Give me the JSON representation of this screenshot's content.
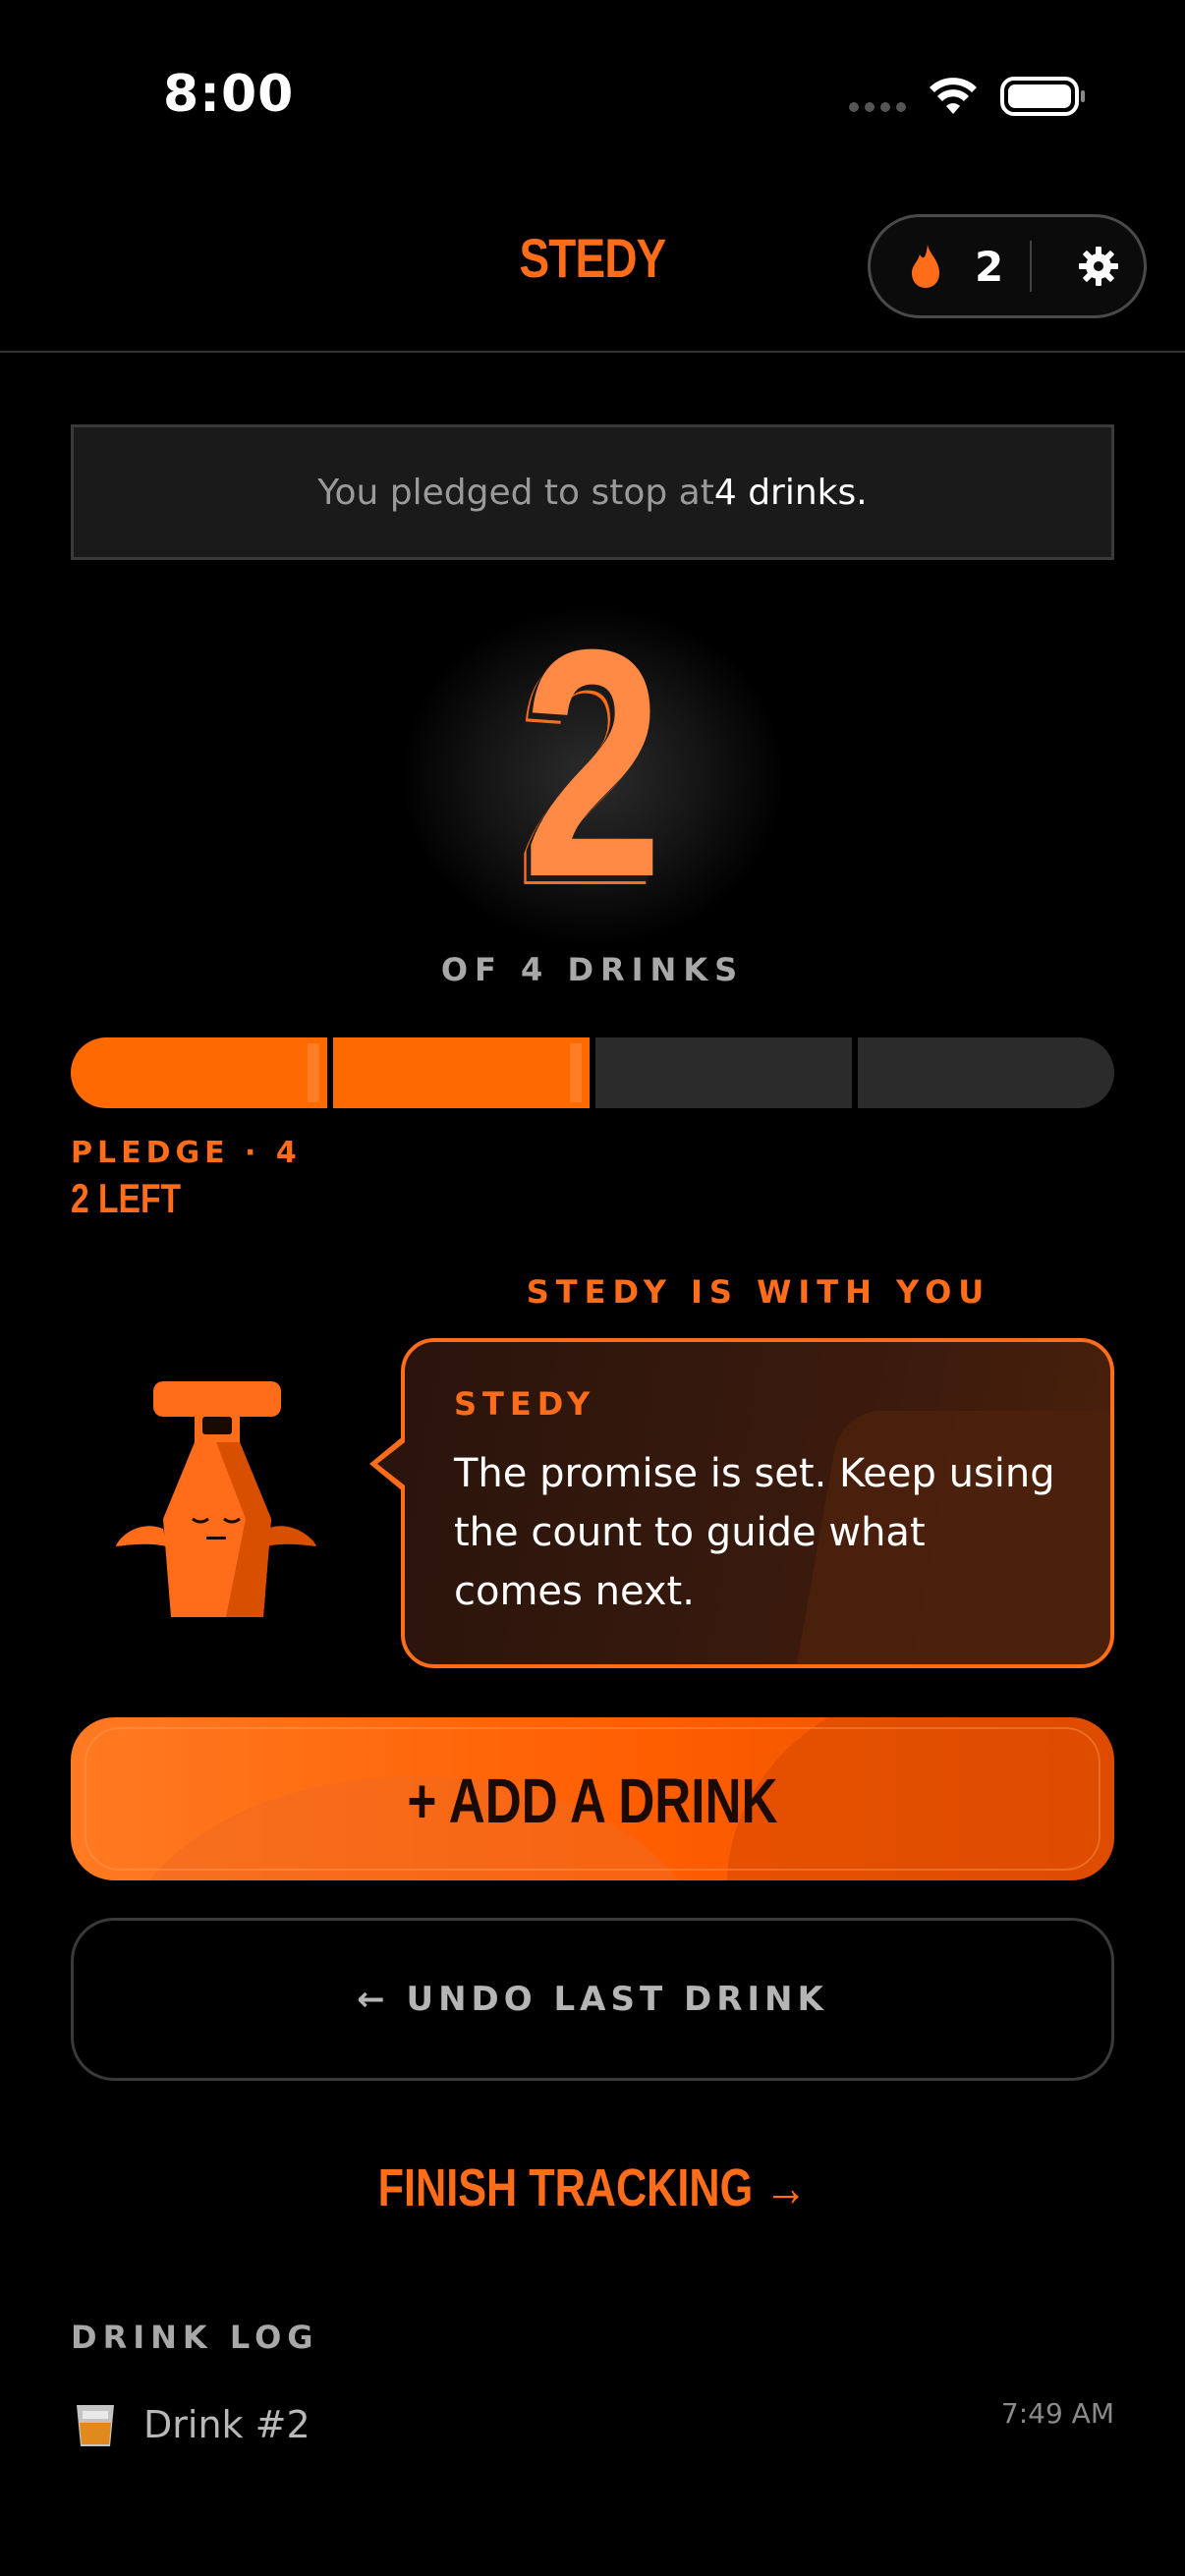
{
  "status_bar": {
    "time": "8:00"
  },
  "header": {
    "brand": "STEDY",
    "streak_count": "2"
  },
  "pledge_banner": {
    "prefix": "You pledged to stop at ",
    "highlight": "4 drinks."
  },
  "counter": {
    "current": "2",
    "caption": "OF 4 DRINKS"
  },
  "progress": {
    "total": 4,
    "filled": 2,
    "pledge_label": "PLEDGE · 4",
    "remaining_label": "2 LEFT"
  },
  "companion": {
    "heading": "STEDY IS WITH YOU",
    "name": "STEDY",
    "message": "The promise is set. Keep using the count to guide what comes next."
  },
  "actions": {
    "add_drink": "+ ADD A DRINK",
    "undo": "← UNDO LAST DRINK",
    "finish": "FINISH TRACKING →"
  },
  "log": {
    "title": "DRINK LOG",
    "entries": [
      {
        "name": "Drink #2",
        "time": "7:49 AM"
      }
    ]
  },
  "colors": {
    "accent": "#ff6d1a",
    "background": "#000000"
  }
}
